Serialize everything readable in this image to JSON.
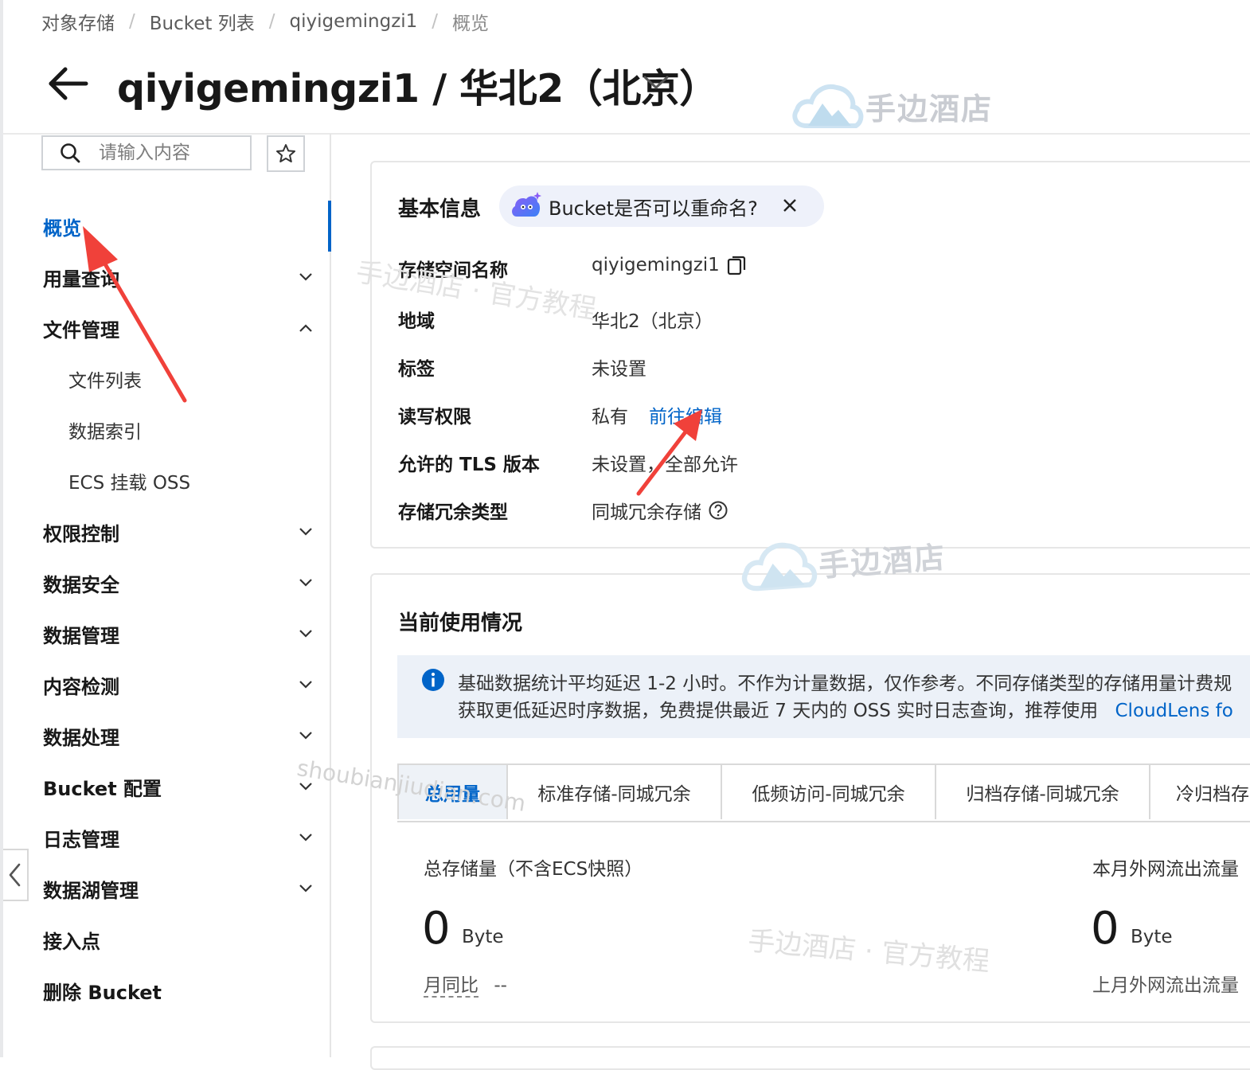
{
  "breadcrumb": [
    "对象存储",
    "Bucket 列表",
    "qiyigemingzi1",
    "概览"
  ],
  "title": "qiyigemingzi1 / 华北2（北京）",
  "watermarks": {
    "logo_text": "手边酒店",
    "tutorial_text": "手边酒店 · 官方教程",
    "url": "shoubianjiudian.com"
  },
  "sidebar": {
    "search_placeholder": "请输入内容",
    "items": [
      {
        "label": "概览",
        "active": true
      },
      {
        "label": "用量查询",
        "expandable": true
      },
      {
        "label": "文件管理",
        "expandable": true,
        "expanded": true
      },
      {
        "label": "权限控制",
        "expandable": true
      },
      {
        "label": "数据安全",
        "expandable": true
      },
      {
        "label": "数据管理",
        "expandable": true
      },
      {
        "label": "内容检测",
        "expandable": true
      },
      {
        "label": "数据处理",
        "expandable": true
      },
      {
        "label": "Bucket 配置",
        "expandable": true
      },
      {
        "label": "日志管理",
        "expandable": true
      },
      {
        "label": "数据湖管理",
        "expandable": true
      },
      {
        "label": "接入点"
      },
      {
        "label": "删除 Bucket"
      }
    ],
    "file_mgmt_sub": [
      "文件列表",
      "数据索引",
      "ECS 挂载 OSS"
    ]
  },
  "basic_info": {
    "title": "基本信息",
    "ai_question": "Bucket是否可以重命名?",
    "rows": [
      {
        "label": "存储空间名称",
        "value": "qiyigemingzi1"
      },
      {
        "label": "地域",
        "value": "华北2（北京）"
      },
      {
        "label": "标签",
        "value": "未设置"
      },
      {
        "label": "读写权限",
        "value": "私有",
        "link": "前往编辑"
      },
      {
        "label": "允许的 TLS 版本",
        "value": "未设置，全部允许"
      },
      {
        "label": "存储冗余类型",
        "value": "同城冗余存储"
      }
    ]
  },
  "usage": {
    "title": "当前使用情况",
    "notice_line1": "基础数据统计平均延迟 1-2 小时。不作为计量数据，仅作参考。不同存储类型的存储用量计费规",
    "notice_line2": "获取更低延迟时序数据，免费提供最近 7 天内的 OSS 实时日志查询，推荐使用",
    "notice_link": "CloudLens fo",
    "tabs": [
      "总用量",
      "标准存储-同城冗余",
      "低频访问-同城冗余",
      "归档存储-同城冗余",
      "冷归档存"
    ],
    "total_storage": {
      "label": "总存储量（不含ECS快照）",
      "value": "0",
      "unit": "Byte",
      "sub_label": "月同比",
      "sub_value": "--"
    },
    "outbound_traffic": {
      "label": "本月外网流出流量",
      "value": "0",
      "unit": "Byte",
      "sub_label": "上月外网流出流量"
    }
  },
  "colors": {
    "accent": "#0064c8",
    "annotation_arrow": "#f0413a"
  }
}
